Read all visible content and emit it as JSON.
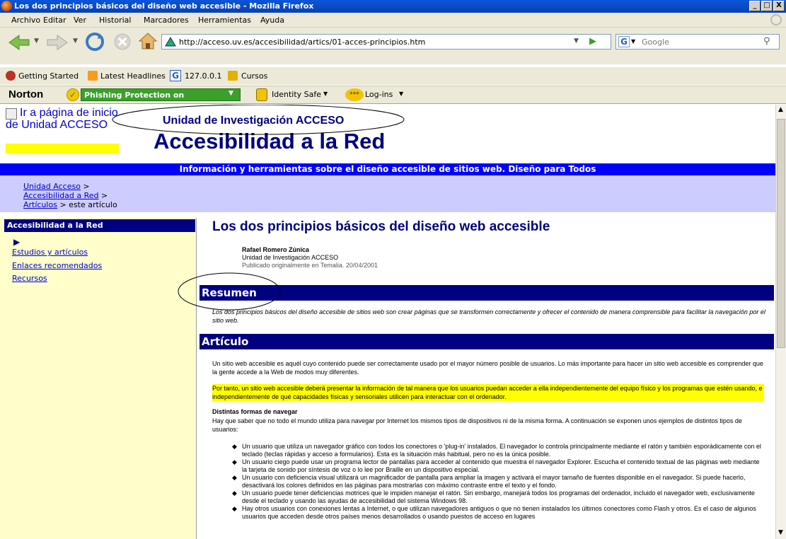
{
  "window": {
    "title": "Los dos principios básicos del diseño web accesible - Mozilla Firefox",
    "buttons": [
      "_",
      "□",
      "X"
    ]
  },
  "menu": [
    "Archivo",
    "Editar",
    "Ver",
    "Historial",
    "Marcadores",
    "Herramientas",
    "Ayuda"
  ],
  "navigation": {
    "url": "http://acceso.uv.es/accesibilidad/artics/01-acces-principios.htm",
    "search_placeholder": "Google"
  },
  "bookmarks": [
    "Getting Started",
    "Latest Headlines",
    "127.0.0.1",
    "Cursos"
  ],
  "norton": {
    "brand": "Norton",
    "phishing": "Phishing Protection on",
    "identity": "Identity Safe",
    "logins": "Log-ins"
  },
  "page": {
    "logo_alt": "Ir a página de inicio de Unidad ACCESO",
    "unit_name": "Unidad de Investigación ACCESO",
    "site_title": "Accesibilidad a la Red",
    "tagline": "Información y herramientas sobre el diseño accesible de sitios web. Diseño para Todos",
    "breadcrumb": [
      "Unidad Acceso",
      "Accesibilidad a Red",
      "Artículos",
      "este artículo"
    ],
    "sidebar": {
      "heading": "Accesibilidad a la Red",
      "links": [
        "Estudios y artículos",
        "Enlaces recomendados",
        "Recursos"
      ]
    },
    "article": {
      "title": "Los dos principios básicos del diseño web accesible",
      "author": "Rafael Romero Zúnica",
      "affiliation": "Unidad de Investigación ACCESO",
      "published": "Publicado originalmente en Temalia. 20/04/2001",
      "summary_heading": "Resumen",
      "summary": "Los dos principios básicos del diseño accesible de sitios web son crear páginas que se transformen correctamente y ofrecer el contenido de manera comprensible para facilitar la navegación por el sitio web.",
      "article_heading": "Artículo",
      "p1": "Un sitio web accesible es aquél cuyo contenido puede ser correctamente usado por el mayor número posible de usuarios. Lo más importante para hacer un sitio web accesible es comprender que la gente accede a la Web de modos muy diferentes.",
      "p2_highlight": "Por tanto, un sitio web accesible deberá presentar la información de tal manera que los usuarios puedan acceder a ella independientemente del equipo físico y los programas que estén usando, e independientemente de qué capacidades físicas y sensoriales utilicen para interactuar con el ordenador.",
      "subheading": "Distintas formas de navegar",
      "p3": "Hay que saber que no todo el mundo utiliza para navegar por Internet los mismos tipos de dispositivos ni de la misma forma. A continuación se exponen unos ejemplos de distintos tipos de usuarios:",
      "bullets": [
        "Un usuario que utiliza un navegador gráfico con todos los conectores o 'plug-in' instalados. El navegador lo controla principalmente mediante el ratón y también esporádicamente con el teclado (teclas rápidas y acceso a formularios). Esta es la situación más habitual, pero no es la única posible.",
        "Un usuario ciego puede usar un programa lector de pantallas para acceder al contenido que muestra el navegador Explorer. Escucha el contenido textual de las páginas web mediante la tarjeta de sonido por síntesis de voz o lo lee por Braille en un dispositivo especial.",
        "Un usuario con deficiencia visual utilizará un magnificador de pantalla para ampliar la imagen y activará el mayor tamaño de fuentes disponible en el navegador. Si puede hacerlo, desactivará los colores definidos en las páginas para mostrarlas con máximo contraste entre el texto y el fondo.",
        "Un usuario puede tener deficiencias motrices que le impiden manejar el ratón. Sin embargo, manejará todos los programas del ordenador, incluido el navegador web, exclusivamente desde el teclado y usando las ayudas de accesibilidad del sistema Windows 98.",
        "Hay otros usuarios con conexiones lentas a Internet, o que utilizan navegadores antiguos o que no tienen instalados los últimos conectores como Flash y otros. Es el caso de algunos usuarios que acceden desde otros países menos desarrollados o usando puestos de acceso en lugares"
      ]
    }
  },
  "colors": {
    "navy": "#000080",
    "blue_band": "#0000ff",
    "sidebar_bg": "#ffffcc",
    "breadcrumb_bg": "#ccccff",
    "highlight": "#ffff00"
  }
}
